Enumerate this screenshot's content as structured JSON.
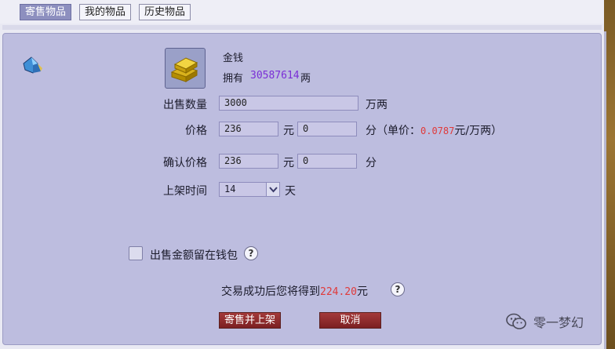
{
  "tabs": [
    {
      "label": "寄售物品"
    },
    {
      "label": "我的物品"
    },
    {
      "label": "历史物品"
    }
  ],
  "item": {
    "name": "金钱",
    "own_label": "拥有",
    "own_value": "30587614",
    "own_unit": "两"
  },
  "form": {
    "quantity_label": "出售数量",
    "quantity_value": "3000",
    "quantity_unit": "万两",
    "price_label": "价格",
    "price_yuan": "236",
    "price_yuan_unit": "元",
    "price_fen": "0",
    "price_fen_unit": "分",
    "unit_price_prefix": "（单价：",
    "unit_price_value": "0.0787",
    "unit_price_suffix": "元/万两）",
    "confirm_label": "确认价格",
    "confirm_yuan": "236",
    "confirm_yuan_unit": "元",
    "confirm_fen": "0",
    "confirm_fen_unit": "分",
    "duration_label": "上架时间",
    "duration_value": "14",
    "duration_unit": "天"
  },
  "wallet_option": {
    "label": "出售金额留在钱包"
  },
  "result": {
    "prefix": "交易成功后您将得到",
    "amount": "224.20",
    "suffix": "元"
  },
  "buttons": {
    "sell": "寄售并上架",
    "cancel": "取消"
  },
  "watermark": {
    "text": "零一梦幻"
  },
  "colors": {
    "accent_purple": "#7a2ed6",
    "accent_red": "#e03a3a",
    "panel": "#bdbddf",
    "button": "#8c2a2e"
  },
  "icons": [
    "gem-icon",
    "gold-bars-icon",
    "chevron-down-icon",
    "question-icon",
    "wechat-icon"
  ]
}
